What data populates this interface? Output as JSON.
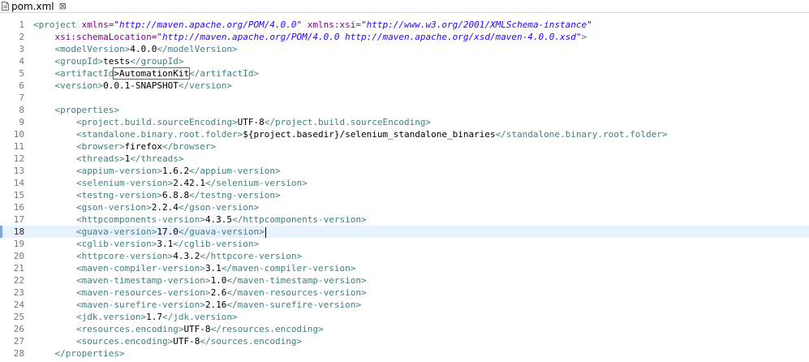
{
  "tab": {
    "title": "pom.xml",
    "close_glyph": "⊠",
    "icon": "xml-file-icon"
  },
  "colors": {
    "tag": "#3f7f7f",
    "attribute": "#7f007f",
    "value": "#2a00ff",
    "current_line": "#e8f2fe"
  },
  "current_line": 18,
  "lines": [
    {
      "n": "1",
      "indent": "",
      "segs": [
        [
          "t",
          "<project "
        ],
        [
          "a",
          "xmlns="
        ],
        [
          "v",
          "\"http://maven.apache.org/POM/4.0.0\""
        ],
        [
          "x",
          " "
        ],
        [
          "a",
          "xmlns:xsi="
        ],
        [
          "v",
          "\"http://www.w3.org/2001/XMLSchema-instance\""
        ]
      ]
    },
    {
      "n": "2",
      "indent": "    ",
      "segs": [
        [
          "a",
          "xsi:schemaLocation="
        ],
        [
          "v",
          "\"http://maven.apache.org/POM/4.0.0 http://maven.apache.org/xsd/maven-4.0.0.xsd\""
        ],
        [
          "t",
          ">"
        ]
      ]
    },
    {
      "n": "3",
      "indent": "    ",
      "segs": [
        [
          "t",
          "<modelVersion>"
        ],
        [
          "x",
          "4.0.0"
        ],
        [
          "t",
          "</modelVersion>"
        ]
      ]
    },
    {
      "n": "4",
      "indent": "    ",
      "segs": [
        [
          "t",
          "<groupId>"
        ],
        [
          "x",
          "tests"
        ],
        [
          "t",
          "</groupId>"
        ]
      ]
    },
    {
      "n": "5",
      "indent": "    ",
      "segs": [
        [
          "t",
          "<artifactId"
        ],
        [
          "b",
          ">AutomationKit"
        ],
        [
          "t",
          "</artifactId>"
        ]
      ]
    },
    {
      "n": "6",
      "indent": "    ",
      "segs": [
        [
          "t",
          "<version>"
        ],
        [
          "x",
          "0.0.1-SNAPSHOT"
        ],
        [
          "t",
          "</version>"
        ]
      ]
    },
    {
      "n": "7",
      "indent": "",
      "segs": []
    },
    {
      "n": "8",
      "indent": "    ",
      "segs": [
        [
          "t",
          "<properties>"
        ]
      ]
    },
    {
      "n": "9",
      "indent": "        ",
      "segs": [
        [
          "t",
          "<project.build.sourceEncoding>"
        ],
        [
          "x",
          "UTF-8"
        ],
        [
          "t",
          "</project.build.sourceEncoding>"
        ]
      ]
    },
    {
      "n": "10",
      "indent": "        ",
      "segs": [
        [
          "t",
          "<standalone.binary.root.folder>"
        ],
        [
          "x",
          "${project.basedir}/selenium_standalone_binaries"
        ],
        [
          "t",
          "</standalone.binary.root.folder>"
        ]
      ]
    },
    {
      "n": "11",
      "indent": "        ",
      "segs": [
        [
          "t",
          "<browser>"
        ],
        [
          "x",
          "firefox"
        ],
        [
          "t",
          "</browser>"
        ]
      ]
    },
    {
      "n": "12",
      "indent": "        ",
      "segs": [
        [
          "t",
          "<threads>"
        ],
        [
          "x",
          "1"
        ],
        [
          "t",
          "</threads>"
        ]
      ]
    },
    {
      "n": "13",
      "indent": "        ",
      "segs": [
        [
          "t",
          "<appium-version>"
        ],
        [
          "x",
          "1.6.2"
        ],
        [
          "t",
          "</appium-version>"
        ]
      ]
    },
    {
      "n": "14",
      "indent": "        ",
      "segs": [
        [
          "t",
          "<selenium-version>"
        ],
        [
          "x",
          "2.42.1"
        ],
        [
          "t",
          "</selenium-version>"
        ]
      ]
    },
    {
      "n": "15",
      "indent": "        ",
      "segs": [
        [
          "t",
          "<testng-version>"
        ],
        [
          "x",
          "6.8.8"
        ],
        [
          "t",
          "</testng-version>"
        ]
      ]
    },
    {
      "n": "16",
      "indent": "        ",
      "segs": [
        [
          "t",
          "<gson-version>"
        ],
        [
          "x",
          "2.2.4"
        ],
        [
          "t",
          "</gson-version>"
        ]
      ]
    },
    {
      "n": "17",
      "indent": "        ",
      "segs": [
        [
          "t",
          "<httpcomponents-version>"
        ],
        [
          "x",
          "4.3.5"
        ],
        [
          "t",
          "</httpcomponents-version>"
        ]
      ]
    },
    {
      "n": "18",
      "indent": "        ",
      "segs": [
        [
          "t",
          "<guava-version>"
        ],
        [
          "x",
          "17.0"
        ],
        [
          "t",
          "</guava-version>"
        ],
        [
          "c",
          ""
        ]
      ]
    },
    {
      "n": "19",
      "indent": "        ",
      "segs": [
        [
          "t",
          "<cglib-version>"
        ],
        [
          "x",
          "3.1"
        ],
        [
          "t",
          "</cglib-version>"
        ]
      ]
    },
    {
      "n": "20",
      "indent": "        ",
      "segs": [
        [
          "t",
          "<httpcore-version>"
        ],
        [
          "x",
          "4.3.2"
        ],
        [
          "t",
          "</httpcore-version>"
        ]
      ]
    },
    {
      "n": "21",
      "indent": "        ",
      "segs": [
        [
          "t",
          "<maven-compiler-version>"
        ],
        [
          "x",
          "3.1"
        ],
        [
          "t",
          "</maven-compiler-version>"
        ]
      ]
    },
    {
      "n": "22",
      "indent": "        ",
      "segs": [
        [
          "t",
          "<maven-timestamp-version>"
        ],
        [
          "x",
          "1.0"
        ],
        [
          "t",
          "</maven-timestamp-version>"
        ]
      ]
    },
    {
      "n": "23",
      "indent": "        ",
      "segs": [
        [
          "t",
          "<maven-resources-version>"
        ],
        [
          "x",
          "2.6"
        ],
        [
          "t",
          "</maven-resources-version>"
        ]
      ]
    },
    {
      "n": "24",
      "indent": "        ",
      "segs": [
        [
          "t",
          "<maven-surefire-version>"
        ],
        [
          "x",
          "2.16"
        ],
        [
          "t",
          "</maven-surefire-version>"
        ]
      ]
    },
    {
      "n": "25",
      "indent": "        ",
      "segs": [
        [
          "t",
          "<jdk.version>"
        ],
        [
          "x",
          "1.7"
        ],
        [
          "t",
          "</jdk.version>"
        ]
      ]
    },
    {
      "n": "26",
      "indent": "        ",
      "segs": [
        [
          "t",
          "<resources.encoding>"
        ],
        [
          "x",
          "UTF-8"
        ],
        [
          "t",
          "</resources.encoding>"
        ]
      ]
    },
    {
      "n": "27",
      "indent": "        ",
      "segs": [
        [
          "t",
          "<sources.encoding>"
        ],
        [
          "x",
          "UTF-8"
        ],
        [
          "t",
          "</sources.encoding>"
        ]
      ]
    },
    {
      "n": "28",
      "indent": "    ",
      "segs": [
        [
          "t",
          "</properties>"
        ]
      ]
    }
  ]
}
